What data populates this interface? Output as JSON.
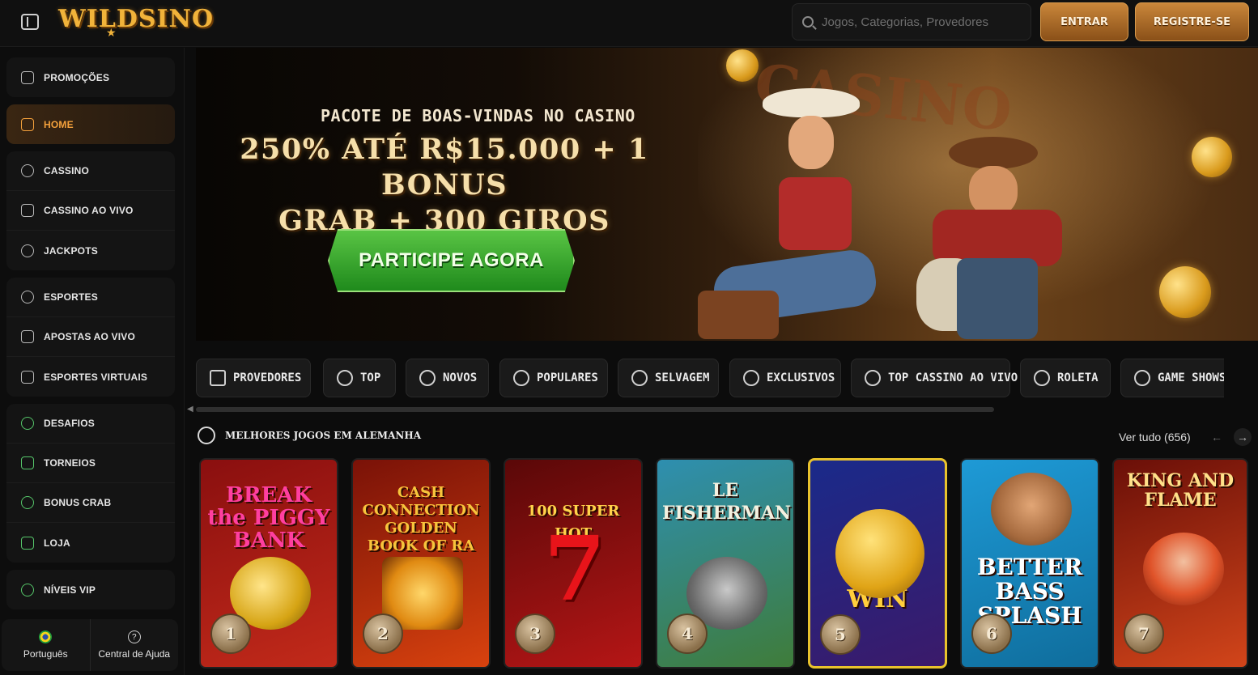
{
  "header": {
    "logo_text": "WILDSINO",
    "search_placeholder": "Jogos, Categorias, Provedores",
    "login_label": "ENTRAR",
    "register_label": "REGISTRE-SE"
  },
  "sidebar": {
    "groups": [
      [
        {
          "label": "PROMOÇÕES",
          "icon": "gift-icon"
        }
      ],
      [
        {
          "label": "HOME",
          "icon": "home-icon",
          "active": true
        }
      ],
      [
        {
          "label": "CASSINO",
          "icon": "chip-icon"
        },
        {
          "label": "CASSINO AO VIVO",
          "icon": "bell-icon"
        },
        {
          "label": "JACKPOTS",
          "icon": "jackpot-icon"
        }
      ],
      [
        {
          "label": "ESPORTES",
          "icon": "ball-icon"
        },
        {
          "label": "APOSTAS AO VIVO",
          "icon": "play-icon"
        },
        {
          "label": "ESPORTES VIRTUAIS",
          "icon": "gamepad-icon"
        }
      ],
      [
        {
          "label": "DESAFIOS",
          "icon": "badge-icon"
        },
        {
          "label": "TORNEIOS",
          "icon": "trophy-icon"
        },
        {
          "label": "BONUS CRAB",
          "icon": "crab-icon"
        },
        {
          "label": "LOJA",
          "icon": "shop-icon"
        }
      ],
      [
        {
          "label": "NÍVEIS VIP",
          "icon": "vip-icon"
        }
      ]
    ],
    "footer": {
      "language_label": "Português",
      "help_label": "Central de Ajuda"
    }
  },
  "hero": {
    "kicker": "PACOTE DE BOAS-VINDAS NO CASINO",
    "title_line1": "250% ATÉ R$15.000 + 1 BONUS",
    "title_line2": "GRAB + 300 GIROS GRÁTIS",
    "cta_label": "PARTICIPE AGORA",
    "sign_text": "CASINO"
  },
  "categories": [
    {
      "label": "PROVEDORES",
      "icon": "grid-icon"
    },
    {
      "label": "TOP",
      "icon": "medal-icon"
    },
    {
      "label": "NOVOS",
      "icon": "rocket-icon"
    },
    {
      "label": "POPULARES",
      "icon": "flame-icon"
    },
    {
      "label": "SELVAGEM",
      "icon": "cactus-icon"
    },
    {
      "label": "EXCLUSIVOS",
      "icon": "diamond-icon"
    },
    {
      "label": "TOP CASSINO AO VIVO",
      "icon": "star-icon"
    },
    {
      "label": "ROLETA",
      "icon": "roulette-icon"
    },
    {
      "label": "GAME SHOWS",
      "icon": "wheel-icon"
    }
  ],
  "section": {
    "title": "MELHORES JOGOS EM ALEMANHA",
    "see_all": "Ver tudo (656)"
  },
  "games": [
    {
      "title": "BREAK the PIGGY BANK",
      "rank": "1",
      "colors": [
        "#8a0f0f",
        "#c22a1a"
      ],
      "title_color": "#ff3fa0"
    },
    {
      "title": "CASH CONNECTION GOLDEN BOOK OF RA",
      "rank": "2",
      "colors": [
        "#7a1208",
        "#d8420e"
      ],
      "title_color": "#f7c43c"
    },
    {
      "title": "100 SUPER HOT",
      "rank": "3",
      "colors": [
        "#5a0808",
        "#b51616"
      ],
      "title_color": "#ffd24a"
    },
    {
      "title": "LE FISHERMAN",
      "rank": "4",
      "colors": [
        "#2e8fb0",
        "#3f7c3a"
      ],
      "title_color": "#f4f1e0"
    },
    {
      "title": "COIN WIN",
      "rank": "5",
      "colors": [
        "#1a2a8a",
        "#3b1a6a"
      ],
      "title_color": "#ffcf3c",
      "selected": true
    },
    {
      "title": "BETTER BASS SPLASH",
      "rank": "6",
      "colors": [
        "#1e9ad6",
        "#0f6d9c"
      ],
      "title_color": "#ffffff"
    },
    {
      "title": "KING AND FLAME",
      "rank": "7",
      "colors": [
        "#6a0f08",
        "#d2451a"
      ],
      "title_color": "#ffe08a"
    }
  ]
}
